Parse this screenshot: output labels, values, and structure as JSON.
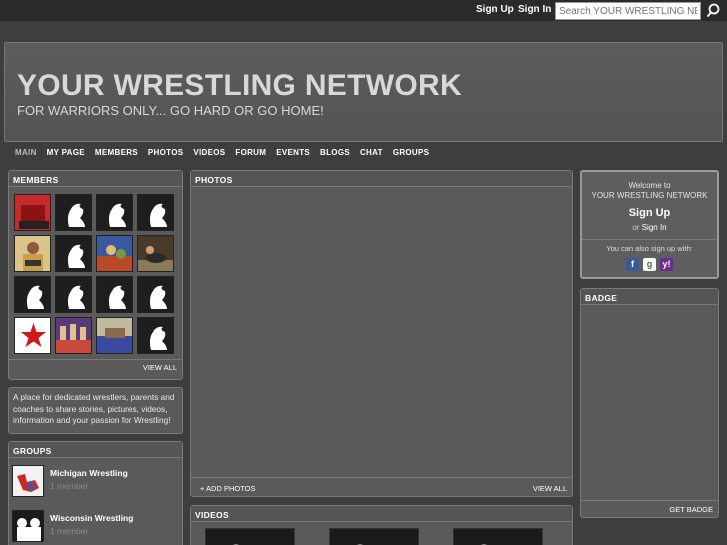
{
  "topbar": {
    "signup_label": "Sign Up",
    "signin_label": "Sign In",
    "search_placeholder": "Search YOUR WRESTLING NETWORK"
  },
  "header": {
    "title": "YOUR WRESTLING NETWORK",
    "tagline": "FOR WARRIORS ONLY... GO HARD OR GO HOME!"
  },
  "nav": {
    "items": [
      "MAIN",
      "MY PAGE",
      "MEMBERS",
      "PHOTOS",
      "VIDEOS",
      "FORUM",
      "EVENTS",
      "BLOGS",
      "CHAT",
      "GROUPS"
    ]
  },
  "members": {
    "heading": "MEMBERS",
    "view_all": "VIEW ALL"
  },
  "about": {
    "text": "A place for dedicated wrestlers, parents and coaches to share stories, pictures, videos, information and your passion for Wrestling!"
  },
  "groups": {
    "heading": "GROUPS",
    "items": [
      {
        "name": "Michigan Wrestling",
        "meta": "1 member"
      },
      {
        "name": "Wisconsin Wrestling",
        "meta": "1 member"
      }
    ]
  },
  "photos": {
    "heading": "PHOTOS",
    "add_label": "+ ADD PHOTOS",
    "view_all": "VIEW ALL"
  },
  "videos": {
    "heading": "VIDEOS"
  },
  "welcome": {
    "line1": "Welcome to",
    "line2": "YOUR WRESTLING NETWORK",
    "signup": "Sign Up",
    "or": "or",
    "signin": "Sign In",
    "also": "You can also sign up with:"
  },
  "badge": {
    "heading": "BADGE",
    "get_label": "GET BADGE"
  },
  "colors": {
    "background": "#3e3e3e",
    "panel": "#5a5a5a",
    "topbar": "#2b2b2b"
  }
}
